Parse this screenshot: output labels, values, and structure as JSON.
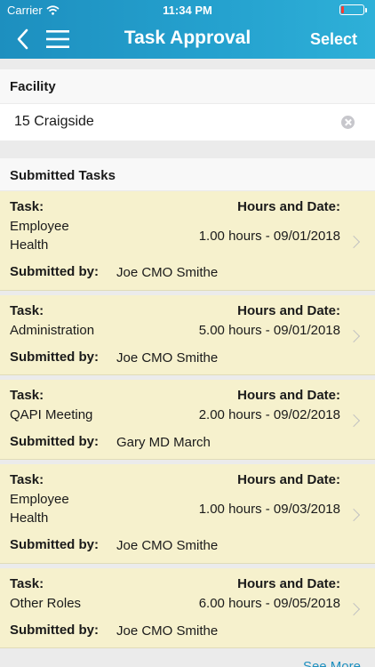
{
  "status_bar": {
    "carrier": "Carrier",
    "time": "11:34 PM",
    "battery_level": 0.12
  },
  "nav": {
    "title": "Task Approval",
    "select_label": "Select",
    "back_icon": "chevron-left-icon",
    "menu_icon": "hamburger-menu-icon"
  },
  "facility": {
    "label": "Facility",
    "value": "15 Craigside"
  },
  "submitted_tasks": {
    "label": "Submitted Tasks",
    "task_label": "Task:",
    "hours_label": "Hours and Date:",
    "submitted_label": "Submitted by:",
    "items": [
      {
        "task_line1": "Employee",
        "task_line2": "Health",
        "hours": "1.00 hours - 09/01/2018",
        "submitted_by": "Joe CMO Smithe"
      },
      {
        "task_line1": "Administration",
        "task_line2": "",
        "hours": "5.00 hours - 09/01/2018",
        "submitted_by": "Joe CMO Smithe"
      },
      {
        "task_line1": "QAPI Meeting",
        "task_line2": "",
        "hours": "2.00 hours - 09/02/2018",
        "submitted_by": "Gary MD March"
      },
      {
        "task_line1": "Employee",
        "task_line2": "Health",
        "hours": "1.00 hours - 09/03/2018",
        "submitted_by": "Joe CMO Smithe"
      },
      {
        "task_line1": "Other Roles",
        "task_line2": "",
        "hours": "6.00 hours - 09/05/2018",
        "submitted_by": "Joe CMO Smithe"
      }
    ]
  },
  "see_more_label": "See More",
  "colors": {
    "header": "#1d8fbf",
    "card": "#f6f1cd",
    "link": "#1d8fbf"
  }
}
